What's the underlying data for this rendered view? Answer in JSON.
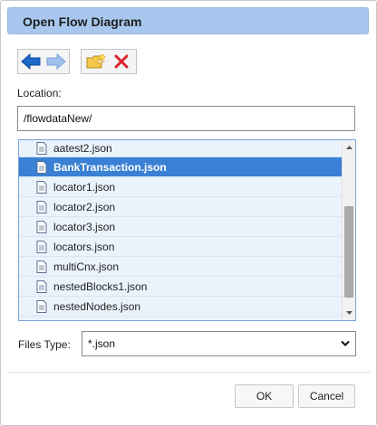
{
  "dialog": {
    "title": "Open Flow Diagram",
    "location_label": "Location:",
    "location_value": "/flowdataNew/",
    "files_type_label": "Files Type:",
    "files_type_value": "*.json",
    "ok_label": "OK",
    "cancel_label": "Cancel"
  },
  "toolbar": {
    "back_icon": "arrow-left-icon",
    "forward_icon": "arrow-right-icon",
    "new_folder_icon": "new-folder-icon",
    "delete_icon": "delete-x-icon"
  },
  "files": [
    {
      "name": "aatest2.json",
      "selected": false
    },
    {
      "name": "BankTransaction.json",
      "selected": true
    },
    {
      "name": "locator1.json",
      "selected": false
    },
    {
      "name": "locator2.json",
      "selected": false
    },
    {
      "name": "locator3.json",
      "selected": false
    },
    {
      "name": "locators.json",
      "selected": false
    },
    {
      "name": "multiCnx.json",
      "selected": false
    },
    {
      "name": "nestedBlocks1.json",
      "selected": false
    },
    {
      "name": "nestedNodes.json",
      "selected": false
    }
  ],
  "colors": {
    "title_bar": "#a8c7ee",
    "selected_row": "#3a80d4",
    "list_background": "#eaf3fc",
    "arrow_blue": "#1c67c9",
    "delete_red": "#d9252b"
  }
}
